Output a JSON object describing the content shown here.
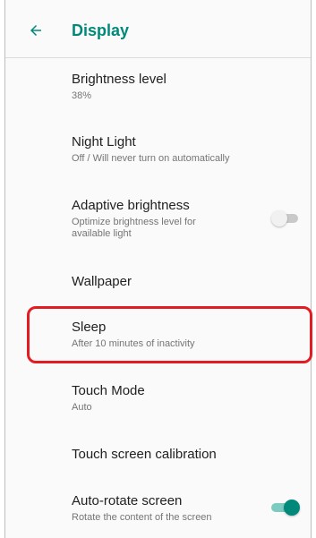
{
  "header": {
    "title": "Display"
  },
  "settings": {
    "brightness": {
      "title": "Brightness level",
      "summary": "38%"
    },
    "night_light": {
      "title": "Night Light",
      "summary": "Off / Will never turn on automatically"
    },
    "adaptive": {
      "title": "Adaptive brightness",
      "summary_line1": "Optimize brightness level for",
      "summary_line2": "available light",
      "enabled": false
    },
    "wallpaper": {
      "title": "Wallpaper"
    },
    "sleep": {
      "title": "Sleep",
      "summary": "After 10 minutes of inactivity"
    },
    "touch_mode": {
      "title": "Touch Mode",
      "summary": "Auto"
    },
    "calibration": {
      "title": "Touch screen calibration"
    },
    "auto_rotate": {
      "title": "Auto-rotate screen",
      "summary": "Rotate the content of the screen",
      "enabled": true
    }
  },
  "colors": {
    "accent": "#00897b",
    "highlight": "#e31b23"
  },
  "icons": {
    "back": "arrow-left-icon"
  }
}
